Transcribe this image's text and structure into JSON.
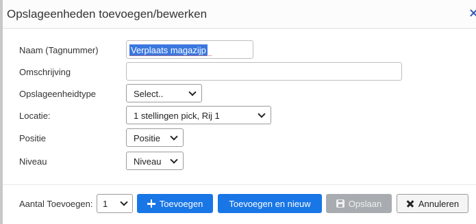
{
  "dialog": {
    "title": "Opslageenheden toevoegen/bewerken"
  },
  "form": {
    "naam": {
      "label": "Naam (Tagnummer)",
      "value": "Verplaats magazijp"
    },
    "omschrijving": {
      "label": "Omschrijving",
      "value": ""
    },
    "type": {
      "label": "Opslageenheidtype",
      "selected": "Select.."
    },
    "locatie": {
      "label": "Locatie:",
      "selected": "1 stellingen pick, Rij 1"
    },
    "positie": {
      "label": "Positie",
      "selected": "Positie"
    },
    "niveau": {
      "label": "Niveau",
      "selected": "Niveau"
    }
  },
  "footer": {
    "aantal_label": "Aantal Toevoegen:",
    "aantal_value": "1",
    "add_label": "Toevoegen",
    "add_new_label": "Toevoegen en nieuw",
    "save_label": "Opslaan",
    "cancel_label": "Annuleren"
  },
  "colors": {
    "primary": "#1976e6",
    "disabled": "#a8acb0",
    "close_icon": "#2b54b4"
  },
  "icons": {
    "close": "close-icon",
    "add": "plus-icon",
    "save": "save-icon",
    "cancel": "x-icon",
    "dropdown": "chevron-down-icon"
  }
}
